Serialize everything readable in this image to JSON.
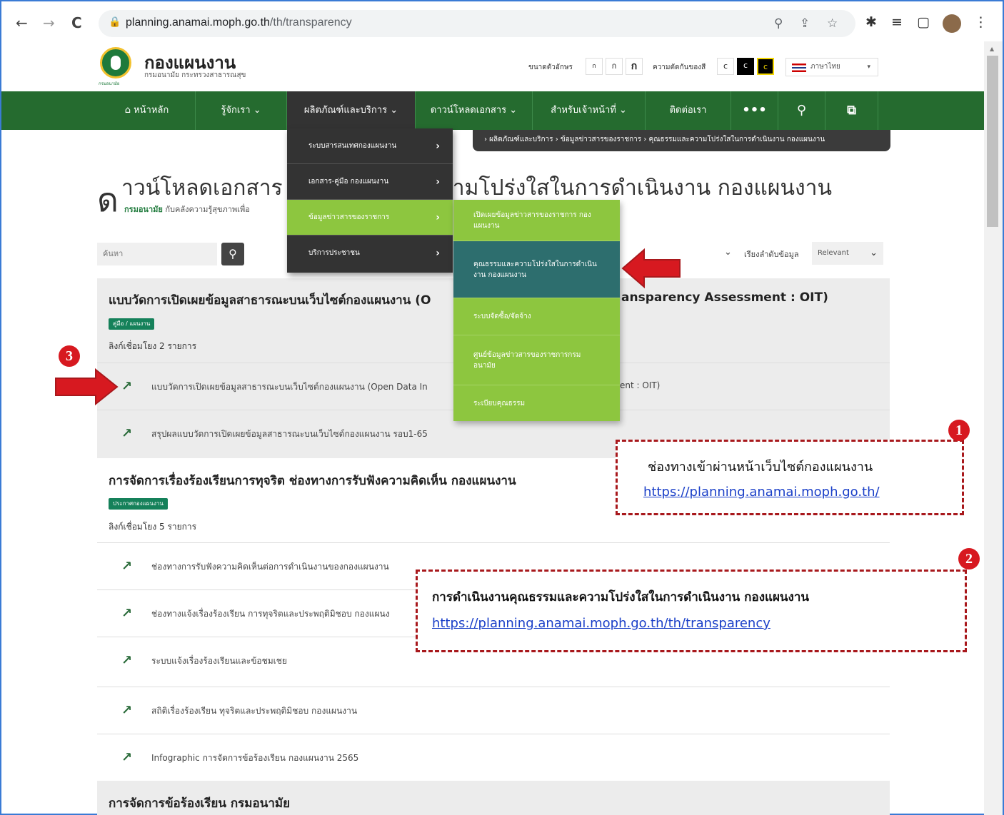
{
  "browser": {
    "back": "←",
    "forward": "→",
    "reload": "C",
    "lock": "🔒",
    "url_domain": "planning.anamai.moph.go.th",
    "url_path": "/th/transparency",
    "zoom_icon": "⚲",
    "share_icon": "⇪",
    "star_icon": "☆",
    "extensions_icon": "✱",
    "list_icon": "≡",
    "sidepanel_icon": "▢",
    "menu_icon": "⋮"
  },
  "site": {
    "logo_caption": "กรมอนามัย",
    "title": "กองแผนงาน",
    "subtitle": "กรมอนามัย กระทรวงสาธารณสุข",
    "font_size_label": "ขนาดตัวอักษร",
    "font_sizes": [
      "ก",
      "ก",
      "ก"
    ],
    "contrast_label": "ความตัดกันของสี",
    "contrast": [
      "c",
      "c",
      "c"
    ],
    "language": "ภาษาไทย",
    "lang_caret": "▾"
  },
  "nav": {
    "items": [
      {
        "label": "⌂ หน้าหลัก"
      },
      {
        "label": "รู้จักเรา ⌄"
      },
      {
        "label": "ผลิตภัณฑ์และบริการ ⌄"
      },
      {
        "label": "ดาวน์โหลดเอกสาร ⌄"
      },
      {
        "label": "สำหรับเจ้าหน้าที่ ⌄"
      },
      {
        "label": "ติดต่อเรา"
      },
      {
        "label": "•••"
      },
      {
        "label": "⚲"
      },
      {
        "label": "⧉"
      }
    ]
  },
  "breadcrumb": "›  ผลิตภัณฑ์และบริการ   ›  ข้อมูลข่าวสารของราชการ   ›  คุณธรรมและความโปร่งใสในการดำเนินงาน กองแผนงาน",
  "page": {
    "title_first": "ด",
    "title_rest": "าวน์โหลดเอกสาร | คุณธรรมและความโปร่งใสในการดำเนินงาน กองแผนงาน",
    "subtitle_bold": "กรมอนามัย",
    "subtitle": " กับคลังความรู้สุขภาพเพื่อ"
  },
  "search": {
    "placeholder": "ค้นหา",
    "button": "⚲",
    "filter_caret": "⌄",
    "sort_label": "เรียงลำดับข้อมูล",
    "sort_value": "Relevant",
    "sort_caret": "⌄"
  },
  "dropdown_level1": [
    {
      "label": "ระบบสารสนเทศกองแผนงาน",
      "arrow": "›"
    },
    {
      "label": "เอกสาร-คู่มือ กองแผนงาน",
      "arrow": "›"
    },
    {
      "label": "ข้อมูลข่าวสารของราชการ",
      "arrow": "›"
    },
    {
      "label": "บริการประชาชน",
      "arrow": "›"
    }
  ],
  "dropdown_level2": [
    {
      "label": "เปิดเผยข้อมูลข่าวสารของราชการ กองแผนงาน"
    },
    {
      "label": "คุณธรรมและความโปร่งใสในการดำเนินงาน กองแผนงาน"
    },
    {
      "label": "ระบบจัดซื้อ/จัดจ้าง"
    },
    {
      "label": "ศูนย์ข้อมูลข่าวสารของราชการกรมอนามัย"
    },
    {
      "label": "ระเบียบคุณธรรม"
    }
  ],
  "sections": [
    {
      "title": "แบบวัดการเปิดเผยข้อมูลสาธารณะบนเว็บไซต์กองแผนงาน (O",
      "title_tail": "ansparency Assessment : OIT)",
      "tag": "คู่มือ / แผนงาน",
      "count": "ลิงก์เชื่อมโยง 2 รายการ",
      "rows": [
        {
          "icon": "↗",
          "text": "แบบวัดการเปิดเผยข้อมูลสาธารณะบนเว็บไซต์กองแผนงาน (Open Data In",
          "tail": "ent : OIT)"
        },
        {
          "icon": "↗",
          "text": "สรุปผลแบบวัดการเปิดเผยข้อมูลสาธารณะบนเว็บไซต์กองแผนงาน รอบ1-65"
        }
      ]
    },
    {
      "title": "การจัดการเรื่องร้องเรียนการทุจริต ช่องทางการรับฟังความคิดเห็น กองแผนงาน",
      "tag": "ประกาศกองแผนงาน",
      "count": "ลิงก์เชื่อมโยง 5 รายการ",
      "rows": [
        {
          "icon": "↗",
          "text": "ช่องทางการรับฟังความคิดเห็นต่อการดำเนินงานของกองแผนงาน"
        },
        {
          "icon": "↗",
          "text": "ช่องทางแจ้งเรื่องร้องเรียน การทุจริตและประพฤติมิชอบ กองแผนง"
        },
        {
          "icon": "↗",
          "text": "ระบบแจ้งเรื่องร้องเรียนและข้อชมเชย"
        },
        {
          "icon": "↗",
          "text": "สถิติเรื่องร้องเรียน ทุจริตและประพฤติมิชอบ กองแผนงาน"
        },
        {
          "icon": "↗",
          "text": "Infographic การจัดการข้อร้องเรียน กองแผนงาน 2565"
        }
      ]
    },
    {
      "title": "การจัดการข้อร้องเรียน กรมอนามัย"
    }
  ],
  "callouts": [
    {
      "badge": "1",
      "line1": "ช่องทางเข้าผ่านหน้าเว็บไซต์กองแผนงาน",
      "link": "https://planning.anamai.moph.go.th/"
    },
    {
      "badge": "2",
      "line1": "การดำเนินงานคุณธรรมและความโปร่งใสในการดำเนินงาน กองแผนงาน",
      "link": "https://planning.anamai.moph.go.th/th/transparency"
    }
  ],
  "step3_badge": "3",
  "colors": {
    "nav_green": "#256b2f",
    "menu_green": "#8dc63f",
    "menu_teal": "#2d6e6e",
    "annotation_red": "#d71920"
  }
}
